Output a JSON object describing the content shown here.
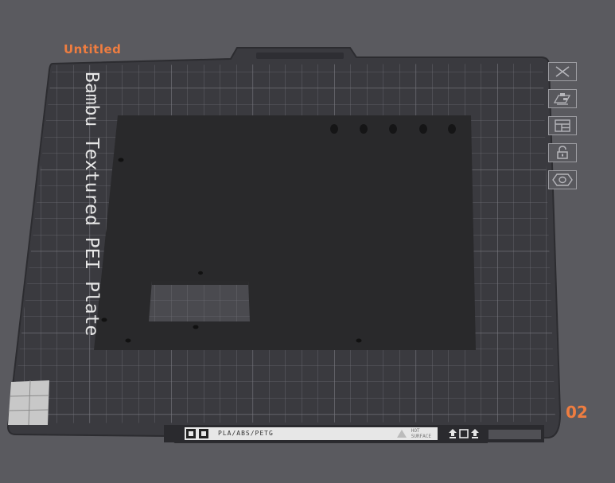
{
  "plate": {
    "title": "Untitled",
    "number": "02",
    "name": "Bambu Textured PEI Plate",
    "filament_label": "PLA/ABS/PETG",
    "hot_surface_line1": "HOT",
    "hot_surface_line2": "SURFACE"
  },
  "toolbar": [
    {
      "name": "delete-plate-button",
      "icon": "close-icon"
    },
    {
      "name": "arrange-button",
      "icon": "arrange-icon"
    },
    {
      "name": "layout-button",
      "icon": "layout-icon"
    },
    {
      "name": "lock-button",
      "icon": "lock-icon"
    },
    {
      "name": "plate-settings-button",
      "icon": "settings-icon"
    }
  ],
  "colors": {
    "accent": "#ef7d40",
    "background": "#5a5a5f",
    "plate": "#3b3b40",
    "grid": "#6a6a70",
    "object": "#28282a"
  }
}
